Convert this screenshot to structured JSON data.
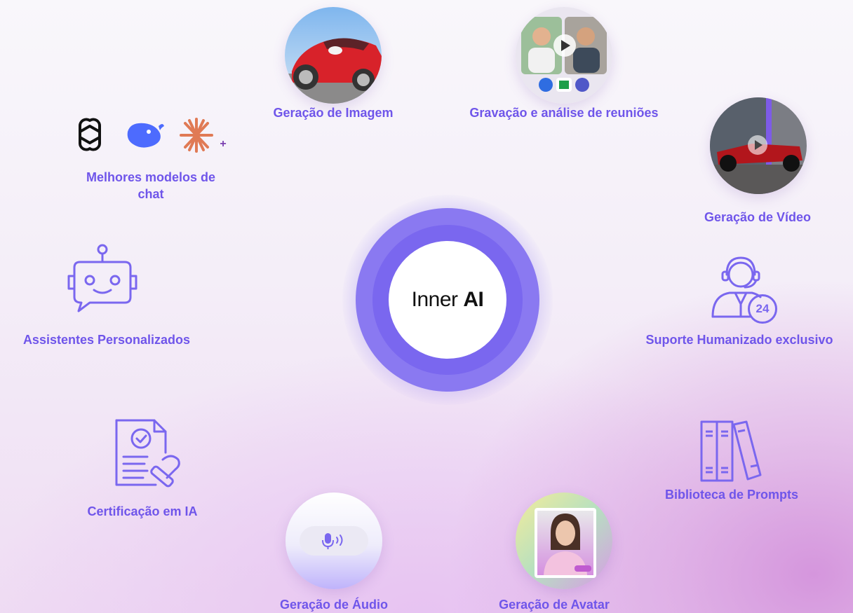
{
  "center": {
    "brand_light": "Inner",
    "brand_bold": "AI"
  },
  "features": {
    "image_generation": "Geração de Imagem",
    "meeting_recording": "Gravação e análise de reuniões",
    "chat_models_line1": "Melhores modelos de",
    "chat_models_line2": "chat",
    "video_generation": "Geração de Vídeo",
    "custom_assistants": "Assistentes Personalizados",
    "human_support": "Suporte Humanizado exclusivo",
    "ai_certification": "Certificação em IA",
    "prompt_library": "Biblioteca de Prompts",
    "audio_generation": "Geração de Áudio",
    "avatar_generation": "Geração de Avatar"
  },
  "support_badge": "24",
  "chat_models_plus": "+",
  "colors": {
    "accent": "#6f55ea",
    "icon_stroke": "#7a67ef",
    "center_ring": "#7a67ef"
  }
}
